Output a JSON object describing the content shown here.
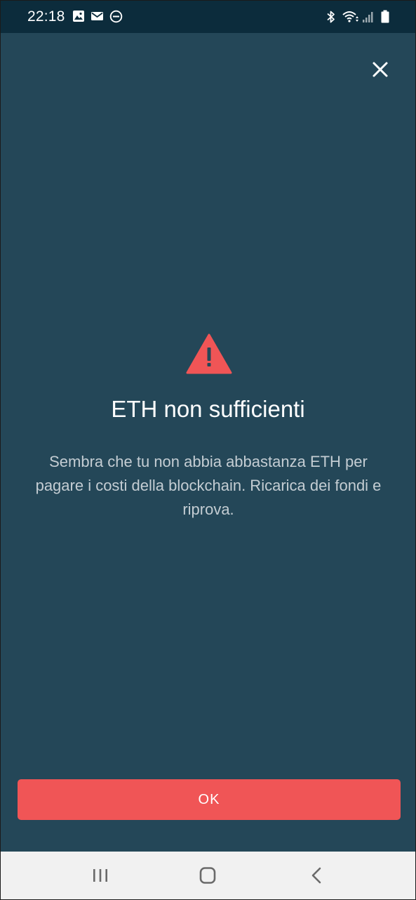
{
  "status_bar": {
    "time": "22:18",
    "left_icons": [
      "image-icon",
      "mail-icon",
      "do-not-disturb-icon"
    ],
    "right_icons": [
      "bluetooth-icon",
      "wifi-icon",
      "signal-icon",
      "battery-icon"
    ]
  },
  "dialog": {
    "close_icon": "close-icon",
    "warning_icon": "warning-icon",
    "title": "ETH non sufficienti",
    "message_lines": [
      "Sembra che tu non abbia abbastanza ETH per",
      "pagare i costi della blockchain. Ricarica dei fondi e",
      "riprova."
    ],
    "ok_label": "OK"
  },
  "colors": {
    "background": "#244758",
    "status_bar": "#0c2c3c",
    "accent": "#f05556",
    "nav_bar": "#f1f1f1"
  },
  "nav_bar": {
    "buttons": [
      "recent-apps-icon",
      "home-icon",
      "back-icon"
    ]
  }
}
